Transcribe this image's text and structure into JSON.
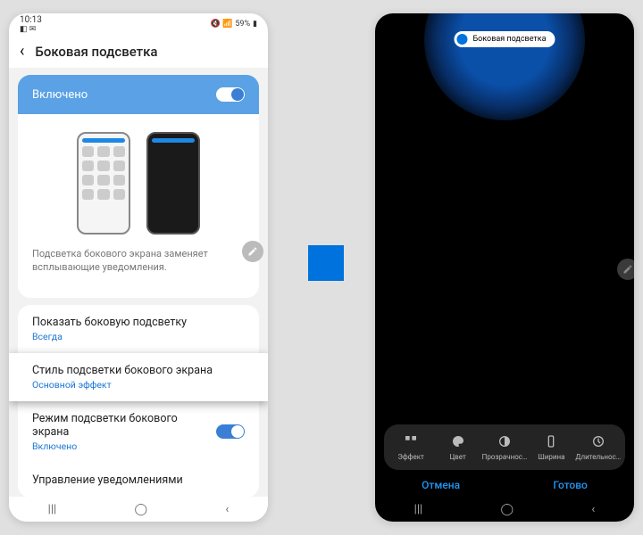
{
  "statusbar": {
    "time": "10:13",
    "battery": "59%"
  },
  "header": {
    "title": "Боковая подсветка"
  },
  "enabled": {
    "label": "Включено"
  },
  "desc": "Подсветка бокового экрана заменяет всплывающие уведомления.",
  "items": {
    "show": {
      "title": "Показать боковую подсветку",
      "sub": "Всегда"
    },
    "style": {
      "title": "Стиль подсветки бокового экрана",
      "sub": "Основной эффект"
    },
    "mode": {
      "title": "Режим подсветки бокового экрана",
      "sub": "Включено"
    },
    "manage": {
      "title": "Управление уведомлениями"
    }
  },
  "right": {
    "pill": "Боковая подсветка",
    "controls": [
      "Эффект",
      "Цвет",
      "Прозрачнос…",
      "Ширина",
      "Длительнос…"
    ],
    "cancel": "Отмена",
    "done": "Готово"
  }
}
